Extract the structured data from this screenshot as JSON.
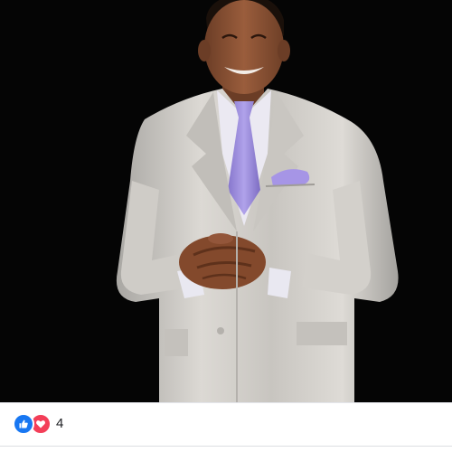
{
  "post": {
    "photo": {
      "description_alt": "",
      "background": "#050505",
      "suit_color": "#d6d3cf",
      "tie_color": "#9b8ad9"
    },
    "reactions": {
      "types": [
        "like-icon",
        "love-icon"
      ],
      "like_color": "#1877f2",
      "love_color": "#f33e58",
      "count": "4"
    }
  }
}
